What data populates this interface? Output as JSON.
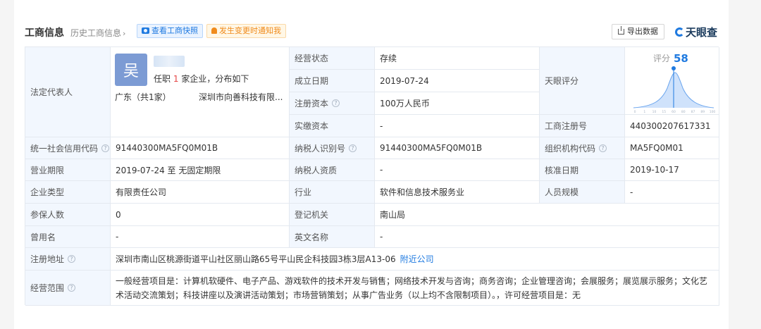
{
  "header": {
    "title": "工商信息",
    "history": "历史工商信息",
    "snapshot_btn": "查看工商快照",
    "notify_btn": "发生变更时通知我",
    "export_btn": "导出数据",
    "brand": "天眼查"
  },
  "legal_rep": {
    "label": "法定代表人",
    "avatar_char": "吴",
    "role_prefix": "任职",
    "role_count": "1",
    "role_suffix": "家企业，分布如下",
    "region": "广东（共1家）",
    "company": "深圳市向善科技有限..."
  },
  "score": {
    "label": "天眼评分",
    "caption": "评分",
    "value": 58,
    "ticks": [
      "0",
      "1",
      "10",
      "15",
      "60",
      "80",
      "87",
      "89",
      "100"
    ]
  },
  "rows": {
    "status": {
      "label": "经营状态",
      "value": "存续"
    },
    "found_date": {
      "label": "成立日期",
      "value": "2019-07-24"
    },
    "reg_capital": {
      "label": "注册资本",
      "value": "100万人民币"
    },
    "paid_capital": {
      "label": "实缴资本",
      "value": "-"
    },
    "reg_no": {
      "label": "工商注册号",
      "value": "440300207617331"
    },
    "credit_code": {
      "label": "统一社会信用代码",
      "value": "91440300MA5FQ0M01B"
    },
    "taxpayer_id": {
      "label": "纳税人识别号",
      "value": "91440300MA5FQ0M01B"
    },
    "org_code": {
      "label": "组织机构代码",
      "value": "MA5FQ0M01"
    },
    "term": {
      "label": "营业期限",
      "value": "2019-07-24  至 无固定期限"
    },
    "tax_qual": {
      "label": "纳税人资质",
      "value": "-"
    },
    "approve_date": {
      "label": "核准日期",
      "value": "2019-10-17"
    },
    "company_type": {
      "label": "企业类型",
      "value": "有限责任公司"
    },
    "industry": {
      "label": "行业",
      "value": "软件和信息技术服务业"
    },
    "staff": {
      "label": "人员规模",
      "value": "-"
    },
    "insured": {
      "label": "参保人数",
      "value": "0"
    },
    "authority": {
      "label": "登记机关",
      "value": "南山局"
    },
    "former_name": {
      "label": "曾用名",
      "value": "-"
    },
    "en_name": {
      "label": "英文名称",
      "value": "-"
    },
    "address": {
      "label": "注册地址",
      "value": "深圳市南山区桃源街道平山社区丽山路65号平山民企科技园3栋3层A13-06",
      "link": "附近公司"
    },
    "scope": {
      "label": "经营范围",
      "value": "一般经营项目是：计算机软硬件、电子产品、游戏软件的技术开发与销售；网络技术开发与咨询；商务咨询；企业管理咨询；会展服务；展览展示服务；文化艺术活动交流策划；科技讲座以及演讲活动策划；市场营销策划；从事广告业务（以上均不含限制项目）。，许可经营项目是：无"
    }
  }
}
